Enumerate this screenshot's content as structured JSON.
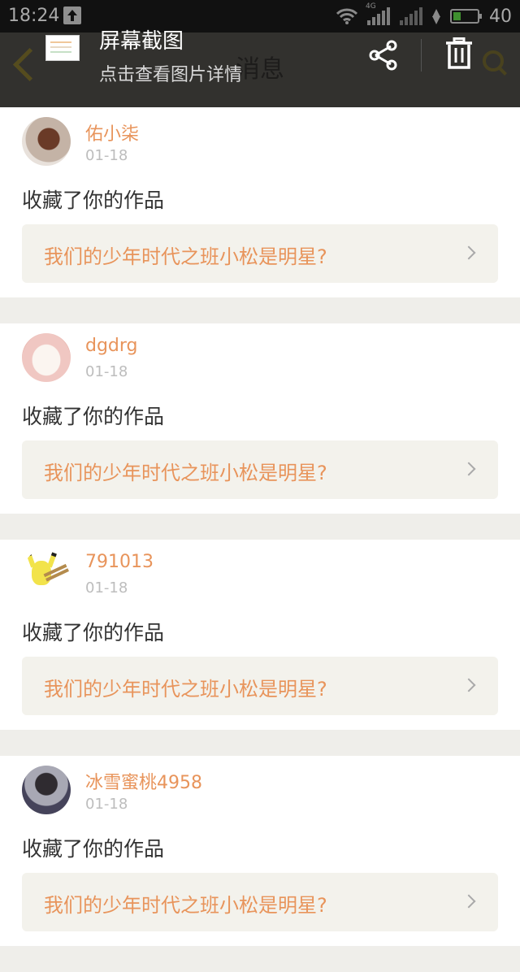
{
  "status_bar": {
    "time": "18:24",
    "network": "4G",
    "battery": "40",
    "battery_level": 0.4
  },
  "header": {
    "title": "消息"
  },
  "screenshot_notice": {
    "title": "屏幕截图",
    "subtitle": "点击查看图片详情"
  },
  "messages": [
    {
      "username": "佑小柒",
      "date": "01-18",
      "action": "收藏了你的作品",
      "work_title": "我们的少年时代之班小松是明星?"
    },
    {
      "username": "dgdrg",
      "date": "01-18",
      "action": "收藏了你的作品",
      "work_title": "我们的少年时代之班小松是明星?"
    },
    {
      "username": "791013",
      "date": "01-18",
      "action": "收藏了你的作品",
      "work_title": "我们的少年时代之班小松是明星?"
    },
    {
      "username": "冰雪蜜桃4958",
      "date": "01-18",
      "action": "收藏了你的作品",
      "work_title": "我们的少年时代之班小松是明星?"
    }
  ],
  "colors": {
    "accent": "#e8945b",
    "link_bg": "#f3f2ec",
    "list_bg": "#efeeea"
  },
  "icons": [
    "upload-icon",
    "wifi-icon",
    "signal-icon",
    "bolt-icon",
    "battery-icon",
    "back-arrow-icon",
    "search-icon",
    "share-icon",
    "trash-icon",
    "chevron-right-icon"
  ]
}
